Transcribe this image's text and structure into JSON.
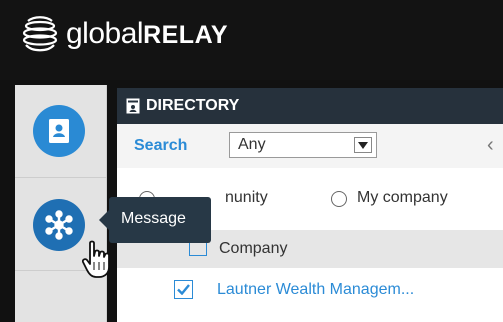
{
  "brand": {
    "name_light": "global",
    "name_bold": "RELAY",
    "logo_icon": "globe-stack-icon"
  },
  "sidebar": {
    "items": [
      {
        "name": "directory",
        "icon": "contact-book-icon",
        "color": "#2a8ad4"
      },
      {
        "name": "message",
        "icon": "network-hub-icon",
        "color": "#1f6fb3"
      }
    ],
    "tooltip": "Message"
  },
  "directory": {
    "title": "DIRECTORY",
    "icon": "directory-icon",
    "search": {
      "label": "Search",
      "selected": "Any"
    },
    "scope": {
      "partial_left": "nunity",
      "option_my_company": "My company"
    },
    "group_label": "Company",
    "results": [
      {
        "label": "Lautner Wealth Managem...",
        "checked": true
      }
    ]
  },
  "colors": {
    "accent": "#2b8bd6",
    "header_bg": "#26313c",
    "topbar_bg": "#131313"
  }
}
